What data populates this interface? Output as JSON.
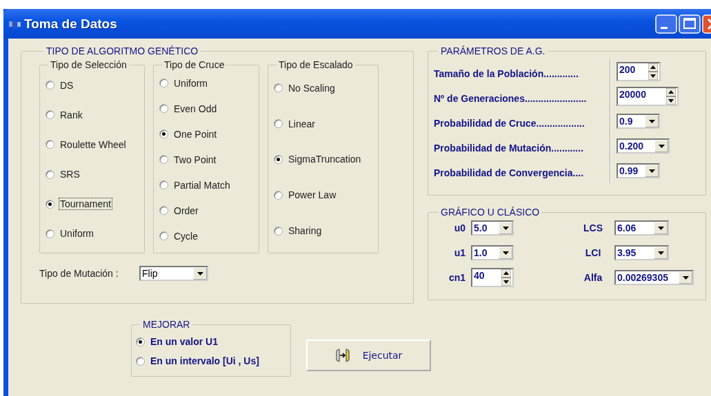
{
  "window": {
    "title": "Toma de Datos"
  },
  "algoritmo": {
    "title": "TIPO DE ALGORITMO GENÉTICO",
    "groups": [
      {
        "title": "Tipo de Selección",
        "options": [
          {
            "label": "DS",
            "selected": false,
            "focused": false
          },
          {
            "label": "Rank",
            "selected": false,
            "focused": false
          },
          {
            "label": "Roulette Wheel",
            "selected": false,
            "focused": false
          },
          {
            "label": "SRS",
            "selected": false,
            "focused": false
          },
          {
            "label": "Tournament",
            "selected": true,
            "focused": true
          },
          {
            "label": "Uniform",
            "selected": false,
            "focused": false
          }
        ]
      },
      {
        "title": "Tipo de Cruce",
        "options": [
          {
            "label": "Uniform",
            "selected": false,
            "focused": false
          },
          {
            "label": "Even Odd",
            "selected": false,
            "focused": false
          },
          {
            "label": "One Point",
            "selected": true,
            "focused": false
          },
          {
            "label": "Two Point",
            "selected": false,
            "focused": false
          },
          {
            "label": "Partial Match",
            "selected": false,
            "focused": false
          },
          {
            "label": "Order",
            "selected": false,
            "focused": false
          },
          {
            "label": "Cycle",
            "selected": false,
            "focused": false
          }
        ]
      },
      {
        "title": "Tipo de Escalado",
        "options": [
          {
            "label": "No Scaling",
            "selected": false,
            "focused": false
          },
          {
            "label": "Linear",
            "selected": false,
            "focused": false
          },
          {
            "label": "SigmaTruncation",
            "selected": true,
            "focused": false
          },
          {
            "label": "Power Law",
            "selected": false,
            "focused": false
          },
          {
            "label": "Sharing",
            "selected": false,
            "focused": false
          }
        ]
      }
    ],
    "mutation": {
      "label": "Tipo de Mutación :",
      "value": "Flip"
    }
  },
  "parametros": {
    "title": "PARÁMETROS DE A.G.",
    "rows": [
      {
        "label": "Tamaño de la Población.............",
        "value": "200",
        "kind": "spinner"
      },
      {
        "label": "Nº de Generaciones.......................",
        "value": "20000",
        "kind": "spinner"
      },
      {
        "label": "Probabilidad de Cruce..................",
        "value": "0.9",
        "kind": "dropdown"
      },
      {
        "label": "Probabilidad de Mutación............",
        "value": "0.200",
        "kind": "dropdown"
      },
      {
        "label": "Probabilidad de Convergencia....",
        "value": "0.99",
        "kind": "dropdown"
      }
    ]
  },
  "grafico": {
    "title": "GRÁFICO U CLÁSICO",
    "left": [
      {
        "label": "u0",
        "value": "5.0",
        "kind": "dropdown"
      },
      {
        "label": "u1",
        "value": "1.0",
        "kind": "dropdown"
      },
      {
        "label": "cn1",
        "value": "40",
        "kind": "spinner"
      }
    ],
    "right": [
      {
        "label": "LCS",
        "value": "6.06",
        "kind": "dropdown"
      },
      {
        "label": "LCI",
        "value": "3.95",
        "kind": "dropdown"
      },
      {
        "label": "Alfa",
        "value": "0.00269305",
        "kind": "dropdown"
      }
    ]
  },
  "mejorar": {
    "title": "MEJORAR",
    "options": [
      {
        "label": "En un valor U1",
        "selected": true
      },
      {
        "label": "En un intervalo [Ui , Us]",
        "selected": false
      }
    ]
  },
  "run_button": {
    "label": "Ejecutar"
  }
}
